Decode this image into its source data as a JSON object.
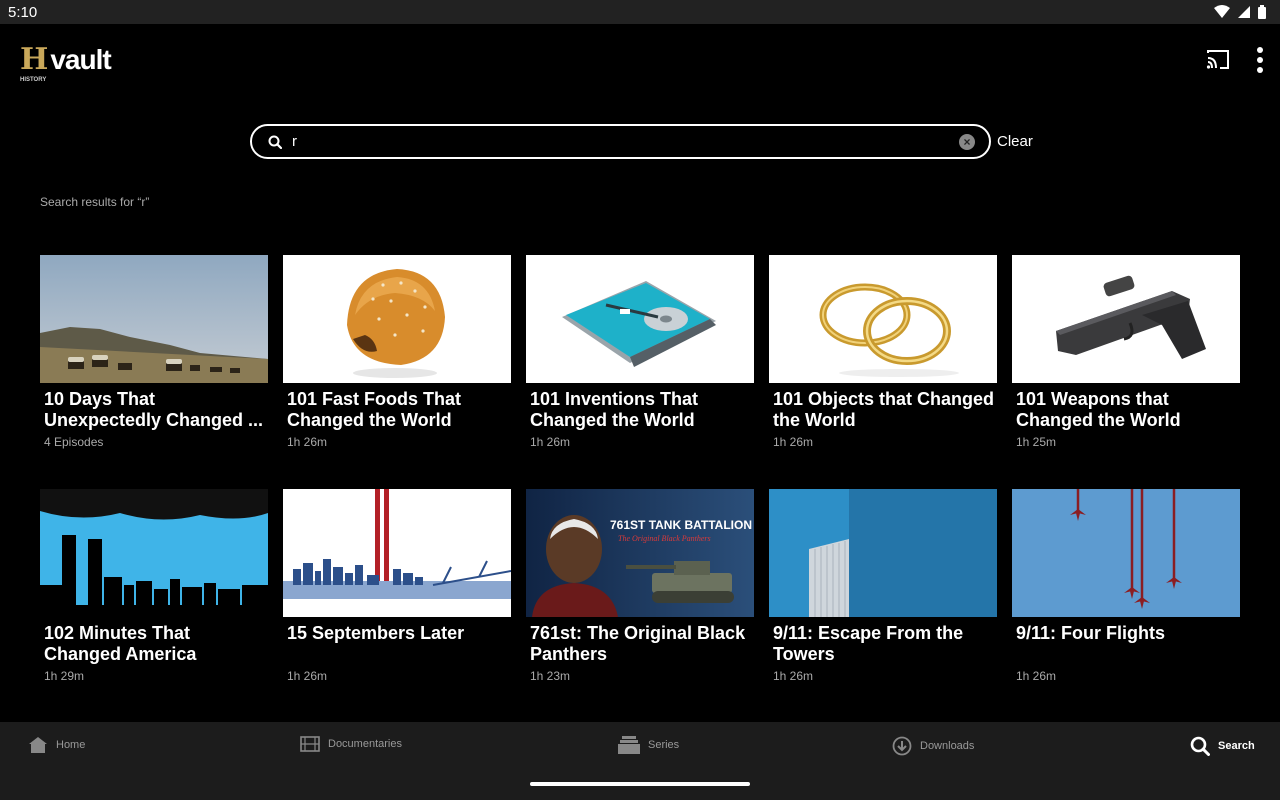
{
  "status": {
    "time": "5:10"
  },
  "app": {
    "logo_mark": "H",
    "logo_text": "vault",
    "logo_sub": "HISTORY"
  },
  "search": {
    "value": "r",
    "clear_label": "Clear"
  },
  "results_caption": "Search results for “r”",
  "results": [
    {
      "title": "10 Days That Unexpectedly Changed ...",
      "meta": "4 Episodes",
      "thumb": "wagon-train"
    },
    {
      "title": "101 Fast Foods That Changed the World",
      "meta": "1h 26m",
      "thumb": "burger-bun"
    },
    {
      "title": "101 Inventions That Changed the World",
      "meta": "1h 26m",
      "thumb": "hard-drive"
    },
    {
      "title": "101 Objects that Changed the World",
      "meta": "1h 26m",
      "thumb": "gold-rings"
    },
    {
      "title": "101 Weapons that Changed the World",
      "meta": "1h 25m",
      "thumb": "pistol"
    },
    {
      "title": "102 Minutes That Changed America",
      "meta": "1h 29m",
      "thumb": "twin-towers-skyline"
    },
    {
      "title": "15 Septembers Later",
      "meta": "1h 26m",
      "thumb": "tribute-in-light"
    },
    {
      "title": "761st: The Original Black Panthers",
      "meta": "1h 23m",
      "thumb": "tank-battalion-poster"
    },
    {
      "title": "9/11: Escape From the Towers",
      "meta": "1h 26m",
      "thumb": "tower-facade"
    },
    {
      "title": "9/11: Four Flights",
      "meta": "1h 26m",
      "thumb": "four-flight-paths"
    }
  ],
  "poster_text": {
    "line1": "761ST TANK BATTALION",
    "line2": "The Original Black Panthers"
  },
  "nav": [
    {
      "label": "Home",
      "icon": "home-icon"
    },
    {
      "label": "Documentaries",
      "icon": "film-icon"
    },
    {
      "label": "Series",
      "icon": "stack-icon"
    },
    {
      "label": "Downloads",
      "icon": "download-icon"
    },
    {
      "label": "Search",
      "icon": "search-icon",
      "active": true
    }
  ],
  "colors": {
    "background": "#000000",
    "bottom_nav": "#1c1c1c",
    "logo_gold": "#c9a85a",
    "muted_text": "#aaaaaa"
  }
}
